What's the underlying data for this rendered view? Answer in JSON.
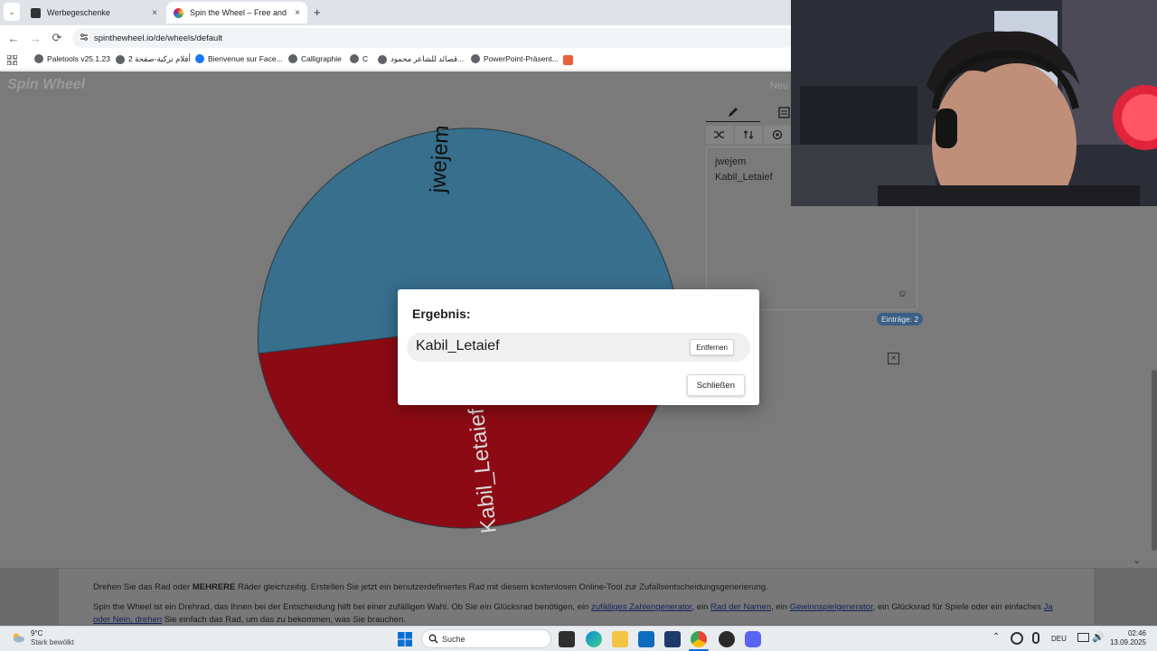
{
  "browser": {
    "tabs": [
      {
        "label": "Werbegeschenke",
        "close": "×",
        "active": false
      },
      {
        "label": "Spin the Wheel – Free and easy",
        "close": "×",
        "active": true
      }
    ],
    "new_tab": "+",
    "url": "spinthewheel.io/de/wheels/default",
    "nav": {
      "back": "←",
      "forward": "→",
      "reload": "⟳"
    },
    "bookmarks": [
      "Paletools v25.1.23",
      "أفلام تركية-صفحة 2",
      "Bienvenue sur Face...",
      "Calligraphie",
      "C",
      "قصائد للشاعر محمود...",
      "PowerPoint-Präsent..."
    ]
  },
  "page": {
    "logo": "Spin Wheel",
    "new_label": "Neu",
    "wheel": {
      "segments": [
        {
          "label": "jwejem",
          "color": "#376f8d"
        },
        {
          "label": "Kabil_Letaief",
          "color": "#8c0a14"
        }
      ]
    },
    "entries": {
      "items": [
        "jwejem",
        "Kabil_Letaief"
      ],
      "count_label": "Einträge: 2",
      "emoji": "☺"
    },
    "modal": {
      "title": "Ergebnis:",
      "result": "Kabil_Letaief",
      "remove_label": "Entfernen",
      "close_label": "Schließen"
    },
    "footer": {
      "line1_pre": "Drehen Sie das Rad oder ",
      "line1_bold": "MEHRERE",
      "line1_post": " Räder gleichzeitig. Erstellen Sie jetzt ein benutzerdefiniertes Rad mit diesem kostenlosen Online-Tool zur Zufallsentscheidungsgenerierung.",
      "line2_a": "Spin the Wheel ist ein Drehrad, das Ihnen bei der Entscheidung hilft bei einer zufälligen Wahl. Ob Sie ein Glücksrad benötigen, ein ",
      "link1": "zufälliges Zahlengenerator",
      "line2_b": ", ein ",
      "link2": "Rad der Namen",
      "line2_c": ", ein ",
      "link3": "Gewinnspielgenerator",
      "line2_d": ", ein Glücksrad für Spiele oder ein einfaches ",
      "link4": "Ja oder Nein, drehen",
      "line2_e": " Sie einfach das Rad, um das zu bekommen, was Sie brauchen."
    }
  },
  "taskbar": {
    "weather_temp": "9°C",
    "weather_desc": "Stark bewölkt",
    "search": "Suche",
    "lang": "DEU",
    "time": "02:46",
    "date": "13.09.2025"
  }
}
